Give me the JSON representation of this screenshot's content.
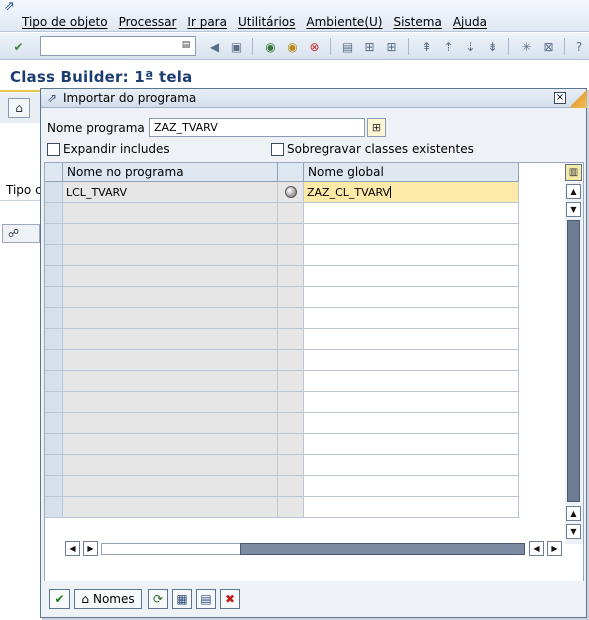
{
  "menubar": {
    "items": [
      "Tipo de objeto",
      "Processar",
      "Ir para",
      "Utilitários",
      "Ambiente(U)",
      "Sistema",
      "Ajuda"
    ]
  },
  "toolbar": {
    "command_value": ""
  },
  "page": {
    "title": "Class Builder: 1ª tela",
    "background_label": "Tipo c"
  },
  "dialog": {
    "title": "Importar do programa",
    "program_label": "Nome programa",
    "program_value": "ZAZ_TVARV",
    "expand_includes_label": "Expandir includes",
    "overwrite_label": "Sobregravar classes existentes",
    "table": {
      "columns": [
        "Nome no programa",
        "Nome global"
      ],
      "rows": [
        {
          "program_name": "LCL_TVARV",
          "global_name": "ZAZ_CL_TVARV"
        }
      ],
      "empty_row_count": 15
    },
    "footer": {
      "names_label": "Nomes"
    }
  },
  "colors": {
    "title": "#1d3e72",
    "selected_cell": "#fde9a8",
    "cancel": "#c41c1c",
    "ok": "#1a7a1a"
  }
}
